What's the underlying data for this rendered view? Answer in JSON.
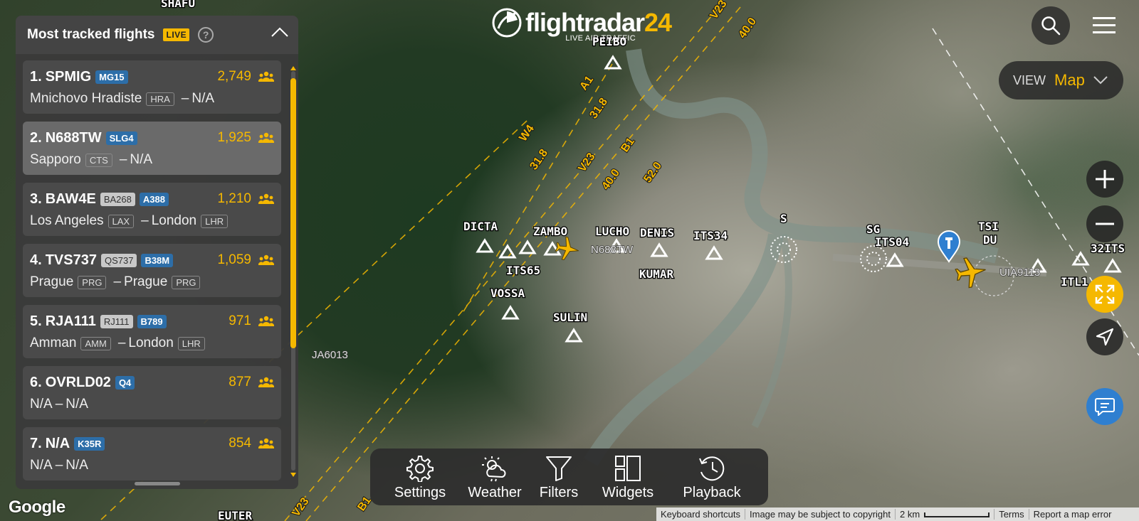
{
  "app": {
    "logo_text": "flightradar",
    "logo_num": "24",
    "logo_sub": "LIVE AIR TRAFFIC"
  },
  "header": {
    "search_icon": "search-icon",
    "menu_icon": "hamburger-menu-icon",
    "view_label": "VIEW",
    "view_value": "Map"
  },
  "panel": {
    "title": "Most tracked flights",
    "live_badge": "LIVE",
    "help": "?",
    "flights": [
      {
        "rank": "1.",
        "callsign": "SPMIG",
        "badges": [
          {
            "text": "MG15",
            "kind": "blue"
          }
        ],
        "count": "2,749",
        "from": "Mnichovo Hradiste",
        "from_code": "HRA",
        "to": "N/A",
        "to_code": "",
        "selected": false
      },
      {
        "rank": "2.",
        "callsign": "N688TW",
        "badges": [
          {
            "text": "SLG4",
            "kind": "blue"
          }
        ],
        "count": "1,925",
        "from": "Sapporo",
        "from_code": "CTS",
        "to": "N/A",
        "to_code": "",
        "selected": true
      },
      {
        "rank": "3.",
        "callsign": "BAW4E",
        "badges": [
          {
            "text": "BA268",
            "kind": "gray"
          },
          {
            "text": "A388",
            "kind": "blue"
          }
        ],
        "count": "1,210",
        "from": "Los Angeles",
        "from_code": "LAX",
        "to": "London",
        "to_code": "LHR",
        "selected": false
      },
      {
        "rank": "4.",
        "callsign": "TVS737",
        "badges": [
          {
            "text": "QS737",
            "kind": "gray"
          },
          {
            "text": "B38M",
            "kind": "blue"
          }
        ],
        "count": "1,059",
        "from": "Prague",
        "from_code": "PRG",
        "to": "Prague",
        "to_code": "PRG",
        "selected": false
      },
      {
        "rank": "5.",
        "callsign": "RJA111",
        "badges": [
          {
            "text": "RJ111",
            "kind": "gray"
          },
          {
            "text": "B789",
            "kind": "blue"
          }
        ],
        "count": "971",
        "from": "Amman",
        "from_code": "AMM",
        "to": "London",
        "to_code": "LHR",
        "selected": false
      },
      {
        "rank": "6.",
        "callsign": "OVRLD02",
        "badges": [
          {
            "text": "Q4",
            "kind": "blue"
          }
        ],
        "count": "877",
        "from": "N/A",
        "from_code": "",
        "to": "N/A",
        "to_code": "",
        "selected": false
      },
      {
        "rank": "7.",
        "callsign": "N/A",
        "badges": [
          {
            "text": "K35R",
            "kind": "blue"
          }
        ],
        "count": "854",
        "from": "N/A",
        "from_code": "",
        "to": "N/A",
        "to_code": "",
        "selected": false
      }
    ]
  },
  "map": {
    "waypoints": [
      "DICTA",
      "ZAMBO",
      "LUCHO",
      "DENIS",
      "ITS34",
      "ITS65",
      "KUMAR",
      "VOSSA",
      "SULIN",
      "S",
      "SG",
      "ITS04",
      "TSI",
      "DU",
      "32ITS",
      "ITL1",
      "PEIBO",
      "SHAFU",
      "EUTER"
    ],
    "airways": [
      "V23",
      "40.0",
      "A1",
      "31.8",
      "W4",
      "31.8",
      "V23",
      "40.0",
      "B1",
      "52.0",
      "V23",
      "B1"
    ],
    "aircraft_labels": [
      "N688TW",
      "UIA9113",
      "JA6013"
    ]
  },
  "toolbar": {
    "settings": "Settings",
    "weather": "Weather",
    "filters": "Filters",
    "widgets": "Widgets",
    "playback": "Playback"
  },
  "footer": {
    "google": "Google",
    "keyboard": "Keyboard shortcuts",
    "copyright": "Image may be subject to copyright",
    "scale": "2 km",
    "terms": "Terms",
    "report": "Report a map error"
  },
  "colors": {
    "accent": "#f5b800",
    "badge_blue": "#2d6ea8",
    "panel_bg": "#3a3a3a",
    "chat_blue": "#2f7fd0"
  }
}
